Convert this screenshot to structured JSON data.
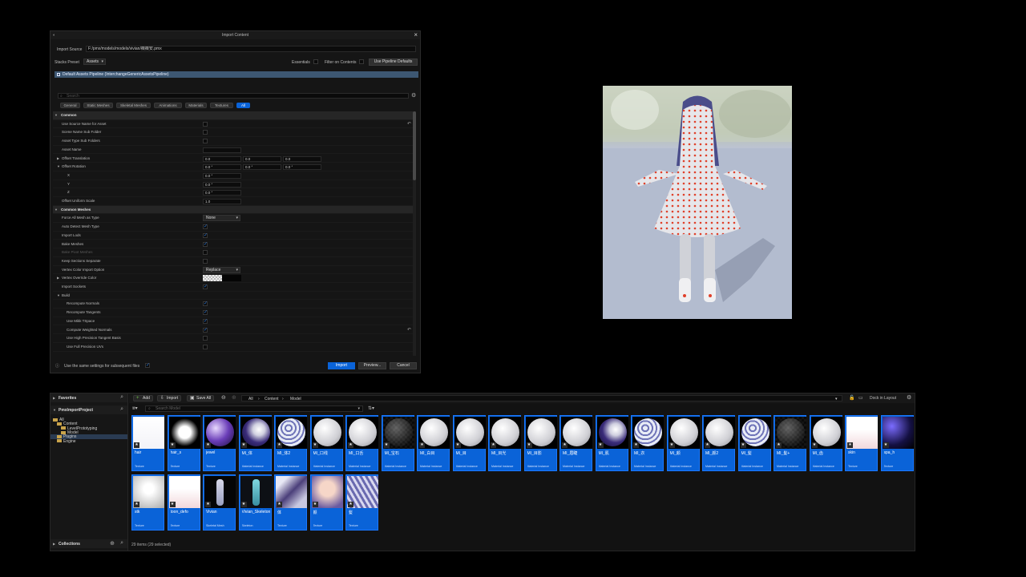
{
  "dialog": {
    "title": "Import Content",
    "import_source_label": "Import Source",
    "import_source_value": "F:/pmx/models/models/vivian/薇薇安.pmx",
    "stacks_preset_label": "Stacks Preset",
    "stacks_preset_value": "Assets",
    "essentials_label": "Essentials",
    "filter_label": "Filter on Contents",
    "use_defaults_label": "Use Pipeline Defaults",
    "pipeline_label": "Default Assets Pipeline (InterchangeGenericAssetsPipeline)",
    "search_placeholder": "Search",
    "tabs": [
      "General",
      "Static Meshes",
      "Skeletal Meshes",
      "Animations",
      "Materials",
      "Textures",
      "All"
    ],
    "rows": [
      {
        "name": "Common",
        "kind": "cat"
      },
      {
        "name": "Use Source Name for Asset",
        "kind": "chk",
        "on": false,
        "reset": true
      },
      {
        "name": "Scene Name Sub Folder",
        "kind": "chk",
        "on": false
      },
      {
        "name": "Asset Type Sub Folders",
        "kind": "chk",
        "on": false
      },
      {
        "name": "Asset Name",
        "kind": "text",
        "value": ""
      },
      {
        "name": "Offset Translation",
        "kind": "vec",
        "values": [
          "0.0",
          "0.0",
          "0.0"
        ],
        "collapsed": true
      },
      {
        "name": "Offset Rotation",
        "kind": "vec",
        "values": [
          "0.0 °",
          "0.0 °",
          "0.0 °"
        ],
        "expanded": true
      },
      {
        "name": "X",
        "kind": "num",
        "value": "0.0 °",
        "indent": 2
      },
      {
        "name": "Y",
        "kind": "num",
        "value": "0.0 °",
        "indent": 2
      },
      {
        "name": "Z",
        "kind": "num",
        "value": "0.0 °",
        "indent": 2
      },
      {
        "name": "Offset Uniform Scale",
        "kind": "num",
        "value": "1.0"
      },
      {
        "name": "Common Meshes",
        "kind": "cat"
      },
      {
        "name": "Force All Mesh as Type",
        "kind": "combo",
        "value": "None"
      },
      {
        "name": "Auto Detect Mesh Type",
        "kind": "chk",
        "on": true
      },
      {
        "name": "Import Lods",
        "kind": "chk",
        "on": true
      },
      {
        "name": "Bake Meshes",
        "kind": "chk",
        "on": true
      },
      {
        "name": "Bake Pivot Meshes",
        "kind": "chk",
        "on": false,
        "disabled": true
      },
      {
        "name": "Keep Sections Separate",
        "kind": "chk",
        "on": false
      },
      {
        "name": "Vertex Color Import Option",
        "kind": "combo",
        "value": "Replace"
      },
      {
        "name": "Vertex Override Color",
        "kind": "color",
        "collapsed": true
      },
      {
        "name": "Import Sockets",
        "kind": "chk",
        "on": true
      },
      {
        "name": "Build",
        "kind": "sub",
        "expanded": true
      },
      {
        "name": "Recompute Normals",
        "kind": "chk",
        "on": true,
        "indent": 1
      },
      {
        "name": "Recompute Tangents",
        "kind": "chk",
        "on": true,
        "indent": 1
      },
      {
        "name": "Use Mikk TSpace",
        "kind": "chk",
        "on": true,
        "indent": 1
      },
      {
        "name": "Compute Weighted Normals",
        "kind": "chk",
        "on": true,
        "indent": 1,
        "reset": true
      },
      {
        "name": "Use High Precision Tangent Basis",
        "kind": "chk",
        "on": false,
        "indent": 1
      },
      {
        "name": "Use Full Precision UVs",
        "kind": "chk",
        "on": false,
        "indent": 1
      }
    ],
    "same_settings_label": "Use the same settings for subsequent files",
    "import_button": "Import",
    "preview_button": "Preview...",
    "cancel_button": "Cancel"
  },
  "content_browser": {
    "favorites_label": "Favorites",
    "project_label": "PmxImportProject",
    "collections_label": "Collections",
    "tree": [
      {
        "label": "All",
        "depth": 0
      },
      {
        "label": "Content",
        "depth": 1
      },
      {
        "label": "LevelPrototyping",
        "depth": 2
      },
      {
        "label": "Model",
        "depth": 2,
        "selected": true
      },
      {
        "label": "Plugins",
        "depth": 1
      },
      {
        "label": "Engine",
        "depth": 1
      }
    ],
    "toolbar": {
      "add": "Add",
      "import": "Import",
      "save_all": "Save All",
      "dock": "Dock in Layout"
    },
    "breadcrumbs": [
      "All",
      "Content",
      "Model"
    ],
    "search_placeholder": "Search Model",
    "status": "29 items (29 selected)",
    "assets": [
      {
        "name": "hair",
        "type": "Texture",
        "look": "white"
      },
      {
        "name": "hair_s",
        "type": "Texture",
        "look": "blob"
      },
      {
        "name": "jewel",
        "type": "Texture",
        "look": "purple"
      },
      {
        "name": "MI_体",
        "type": "Material Instance",
        "look": "dark"
      },
      {
        "name": "MI_体2",
        "type": "Material Instance",
        "look": "pattern"
      },
      {
        "name": "MI_口线",
        "type": "Material Instance",
        "look": "plain"
      },
      {
        "name": "MI_口舌",
        "type": "Material Instance",
        "look": "plain"
      },
      {
        "name": "MI_宝石",
        "type": "Material Instance",
        "look": "checker"
      },
      {
        "name": "MI_白目",
        "type": "Material Instance",
        "look": "plain"
      },
      {
        "name": "MI_目",
        "type": "Material Instance",
        "look": "plain"
      },
      {
        "name": "MI_目光",
        "type": "Material Instance",
        "look": "plain"
      },
      {
        "name": "MI_目影",
        "type": "Material Instance",
        "look": "plain"
      },
      {
        "name": "MI_眉睫",
        "type": "Material Instance",
        "look": "plain"
      },
      {
        "name": "MI_肌",
        "type": "Material Instance",
        "look": "dark"
      },
      {
        "name": "MI_衣",
        "type": "Material Instance",
        "look": "pattern"
      },
      {
        "name": "MI_颜",
        "type": "Material Instance",
        "look": "plain"
      },
      {
        "name": "MI_颜2",
        "type": "Material Instance",
        "look": "plain"
      },
      {
        "name": "MI_髪",
        "type": "Material Instance",
        "look": "pattern"
      },
      {
        "name": "MI_髪+",
        "type": "Material Instance",
        "look": "checker"
      },
      {
        "name": "MI_齿",
        "type": "Material Instance",
        "look": "plain"
      },
      {
        "name": "skin",
        "type": "Texture",
        "look": "white2"
      },
      {
        "name": "spa_h",
        "type": "Texture",
        "look": "galaxy"
      },
      {
        "name": "stk",
        "type": "Texture",
        "look": "grey"
      },
      {
        "name": "toon_defo",
        "type": "Texture",
        "look": "white2"
      },
      {
        "name": "Vivian",
        "type": "Skeletal Mesh",
        "look": "char"
      },
      {
        "name": "Vivian_Skeleton",
        "type": "Skeleton",
        "look": "char2"
      },
      {
        "name": "体",
        "type": "Texture",
        "look": "tex1"
      },
      {
        "name": "颜",
        "type": "Texture",
        "look": "tex2"
      },
      {
        "name": "髪",
        "type": "Texture",
        "look": "tex3"
      }
    ]
  }
}
